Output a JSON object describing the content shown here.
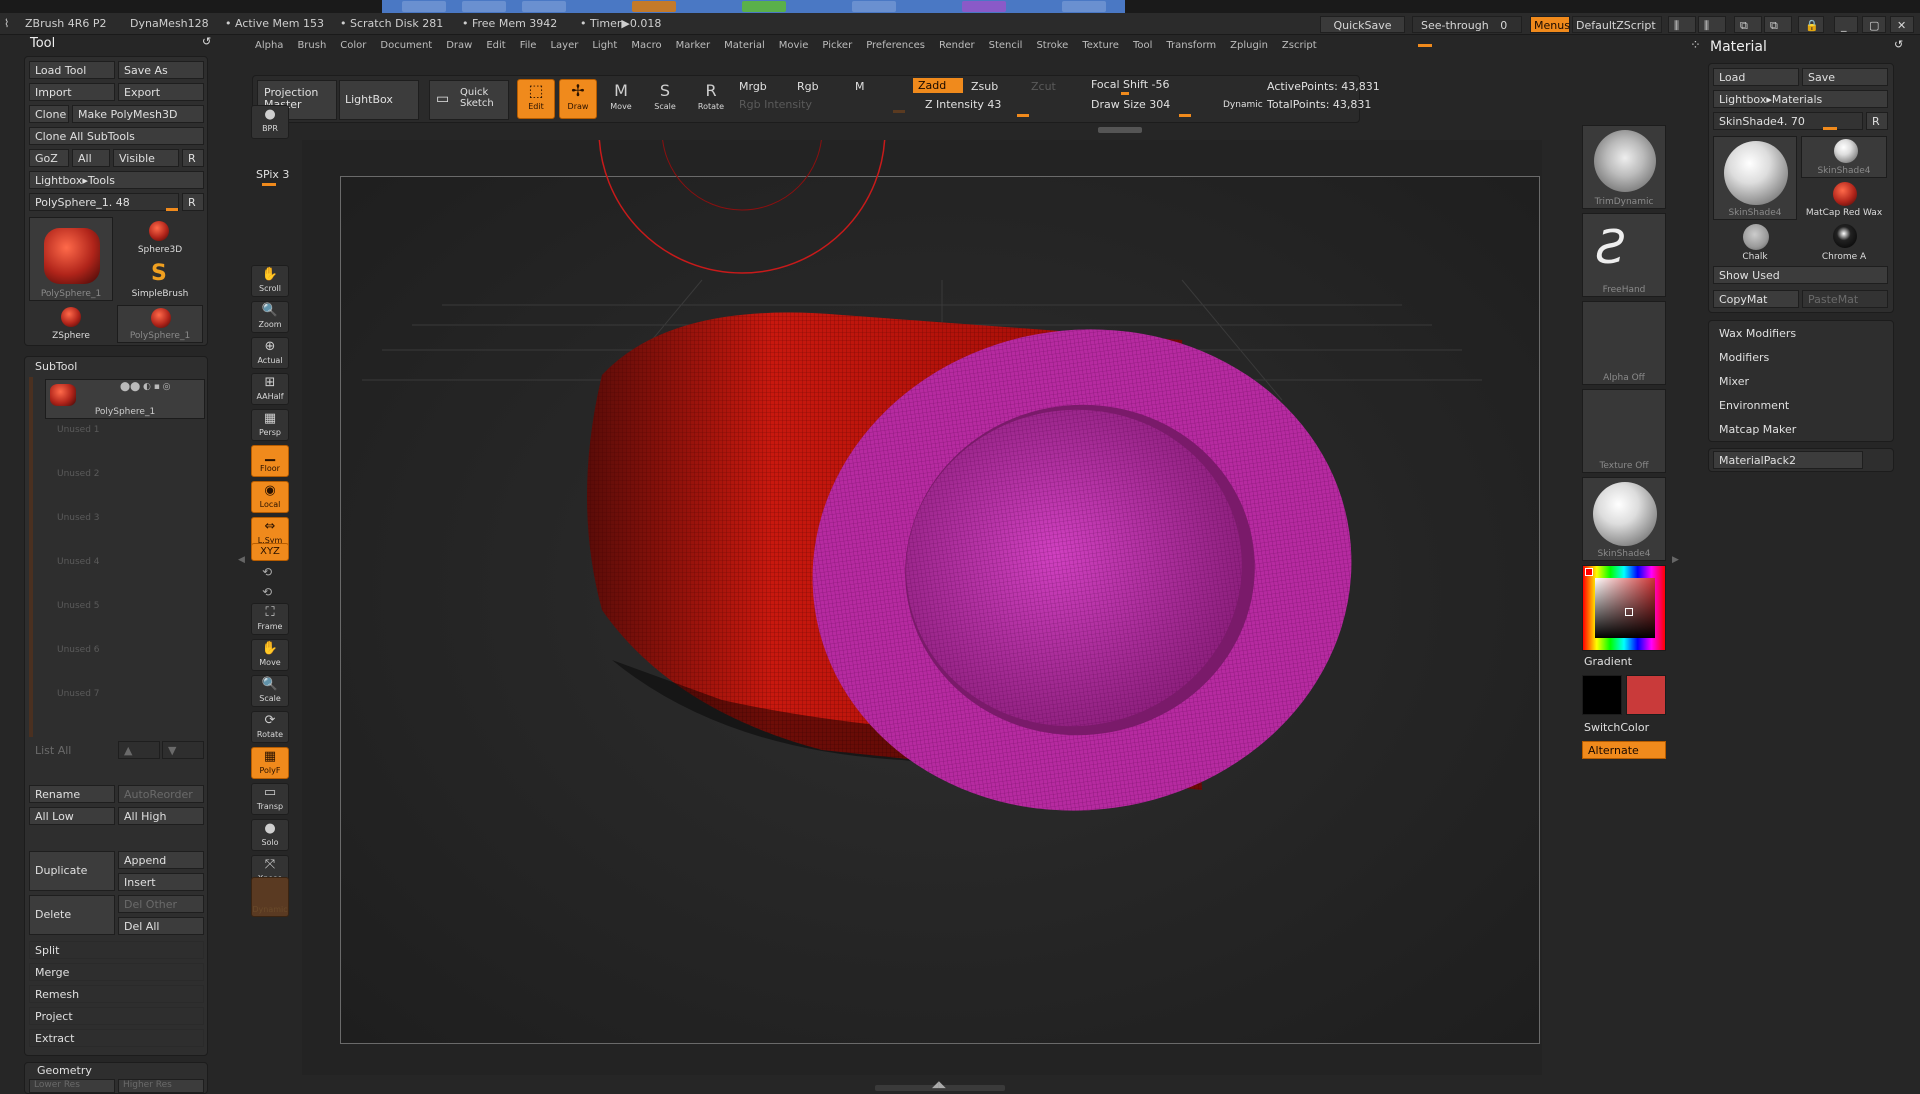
{
  "app": {
    "title": "ZBrush 4R6 P2",
    "dynamesh": "DynaMesh128",
    "active_mem": "• Active Mem 153",
    "scratch_disk": "• Scratch Disk 281",
    "free_mem": "• Free Mem 3942",
    "timer": "• Timer▶0.018"
  },
  "titlebar_right": {
    "quicksave": "QuickSave",
    "see_through": "See-through",
    "see_through_value": "0",
    "menus": "Menus",
    "default_zscript": "DefaultZScript"
  },
  "menus": [
    "Alpha",
    "Brush",
    "Color",
    "Document",
    "Draw",
    "Edit",
    "File",
    "Layer",
    "Light",
    "Macro",
    "Marker",
    "Material",
    "Movie",
    "Picker",
    "Preferences",
    "Render",
    "Stencil",
    "Stroke",
    "Texture",
    "Tool",
    "Transform",
    "Zplugin",
    "Zscript"
  ],
  "tool_panel": {
    "title": "Tool",
    "load_tool": "Load Tool",
    "save_as": "Save As",
    "import": "Import",
    "export": "Export",
    "clone": "Clone",
    "make_polymesh": "Make PolyMesh3D",
    "clone_all_subtools": "Clone All SubTools",
    "goz": "GoZ",
    "all": "All",
    "visible": "Visible",
    "r": "R",
    "lightbox_tools": "Lightbox▸Tools",
    "current_tool": "PolySphere_1. 48",
    "tool_thumbs": [
      "PolySphere_1",
      "Sphere3D",
      "SimpleBrush",
      "ZSphere",
      "PolySphere_1"
    ]
  },
  "subtool": {
    "title": "SubTool",
    "active": "PolySphere_1",
    "unused": [
      "Unused 1",
      "Unused 2",
      "Unused 3",
      "Unused 4",
      "Unused 5",
      "Unused 6",
      "Unused 7"
    ],
    "list_all": "List All",
    "rename": "Rename",
    "auto_reorder": "AutoReorder",
    "all_low": "All Low",
    "all_high": "All High",
    "duplicate": "Duplicate",
    "append": "Append",
    "insert": "Insert",
    "delete": "Delete",
    "del_other": "Del Other",
    "del_all": "Del All",
    "split": "Split",
    "merge": "Merge",
    "remesh": "Remesh",
    "project": "Project",
    "extract": "Extract",
    "geometry": "Geometry",
    "lower_res": "Lower Res",
    "higher_res": "Higher Res"
  },
  "top_shelf": {
    "projection_master": "Projection Master",
    "lightbox": "LightBox",
    "quick_sketch": "Quick Sketch",
    "edit": "Edit",
    "draw": "Draw",
    "move": "Move",
    "scale": "Scale",
    "rotate": "Rotate",
    "mrgb": "Mrgb",
    "rgb": "Rgb",
    "m": "M",
    "rgb_intensity": "Rgb Intensity",
    "zadd": "Zadd",
    "zsub": "Zsub",
    "zcut": "Zcut",
    "z_intensity": "Z Intensity 43",
    "focal_shift": "Focal Shift -56",
    "draw_size": "Draw Size 304",
    "dynamic": "Dynamic",
    "active_points": "ActivePoints: 43,831",
    "total_points": "TotalPoints: 43,831"
  },
  "left_shelf": [
    {
      "label": "BPR",
      "icon": "bpr-icon",
      "glyph": "●",
      "on": false
    },
    {
      "label": "Scroll",
      "icon": "scroll-icon",
      "glyph": "✋",
      "on": false
    },
    {
      "label": "Zoom",
      "icon": "zoom-icon",
      "glyph": "🔍",
      "on": false
    },
    {
      "label": "Actual",
      "icon": "actual-icon",
      "glyph": "⊕",
      "on": false
    },
    {
      "label": "AAHalf",
      "icon": "aahalf-icon",
      "glyph": "⊞",
      "on": false
    },
    {
      "label": "Persp",
      "icon": "persp-icon",
      "glyph": "▦",
      "on": false
    },
    {
      "label": "Floor",
      "icon": "floor-icon",
      "glyph": "▁",
      "on": true
    },
    {
      "label": "Local",
      "icon": "local-icon",
      "glyph": "◉",
      "on": true
    },
    {
      "label": "L.Sym",
      "icon": "lsym-icon",
      "glyph": "⇔",
      "on": true
    }
  ],
  "left_shelf2": [
    {
      "label": "Frame",
      "icon": "frame-icon",
      "glyph": "⛶",
      "on": false
    },
    {
      "label": "Move",
      "icon": "move-icon",
      "glyph": "✋",
      "on": false
    },
    {
      "label": "Scale",
      "icon": "scale-icon",
      "glyph": "🔍",
      "on": false
    },
    {
      "label": "Rotate",
      "icon": "rotate-icon",
      "glyph": "⟳",
      "on": false
    },
    {
      "label": "PolyF",
      "icon": "polyf-icon",
      "glyph": "▦",
      "on": true
    },
    {
      "label": "Transp",
      "icon": "transp-icon",
      "glyph": "▭",
      "on": false
    },
    {
      "label": "Solo",
      "icon": "solo-icon",
      "glyph": "●",
      "on": false
    },
    {
      "label": "Xpose",
      "icon": "xpose-icon",
      "glyph": "⤧",
      "on": false
    }
  ],
  "spix": "SPix 3",
  "xyz": "XYZ",
  "dynamic_label": "Dynamic",
  "right_shelf": {
    "trim_dynamic": "TrimDynamic",
    "freehand": "FreeHand",
    "alpha_off": "Alpha Off",
    "texture_off": "Texture Off",
    "skinshade4": "SkinShade4",
    "gradient": "Gradient",
    "switch_color": "SwitchColor",
    "alternate": "Alternate",
    "secondary_color": "#c93a3a",
    "primary_color": "#000000"
  },
  "material_panel": {
    "title": "Material",
    "load": "Load",
    "save": "Save",
    "lightbox_materials": "Lightbox▸Materials",
    "current": "SkinShade4. 70",
    "r": "R",
    "thumbs": [
      "SkinShade4",
      "SkinShade4",
      "MatCap Red Wax",
      "Chalk",
      "Chrome A"
    ],
    "show_used": "Show Used",
    "copy_mat": "CopyMat",
    "paste_mat": "PasteMat",
    "sections": [
      "Wax Modifiers",
      "Modifiers",
      "Mixer",
      "Environment",
      "Matcap Maker"
    ],
    "material_pack": "MaterialPack2"
  }
}
